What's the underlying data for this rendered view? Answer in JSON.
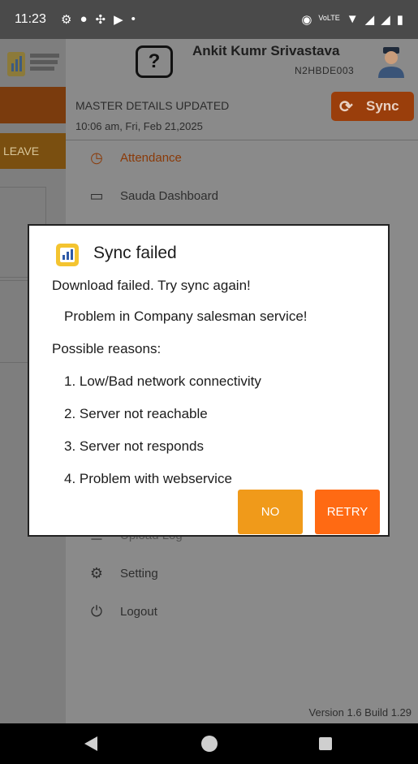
{
  "status_bar": {
    "time": "11:23",
    "left_icons": [
      "settings-icon",
      "chat-icon",
      "cast-icon",
      "youtube-icon",
      "dot-icon"
    ],
    "right_icons": [
      "location-icon",
      "volte-icon",
      "wifi-icon",
      "signal-icon",
      "signal-icon",
      "battery-icon"
    ]
  },
  "background": {
    "leave_label": "LEAVE"
  },
  "header": {
    "help_label": "?",
    "user_name": "Ankit Kumr Srivastava",
    "user_code": "N2HBDE003"
  },
  "sync_panel": {
    "status": "MASTER DETAILS UPDATED",
    "time": "10:06 am, Fri, Feb 21,2025",
    "sync_button": "Sync"
  },
  "menu": {
    "items": [
      {
        "label": "Attendance",
        "icon": "clock-icon"
      },
      {
        "label": "Sauda Dashboard",
        "icon": "monitor-icon"
      },
      {
        "label": "Upload Log",
        "icon": "upload-icon"
      },
      {
        "label": "Setting",
        "icon": "gear-icon"
      },
      {
        "label": "Logout",
        "icon": "power-icon"
      }
    ]
  },
  "version": "Version 1.6 Build 1.29",
  "dialog": {
    "title": "Sync failed",
    "message": "Download failed. Try sync again!",
    "detail": "Problem in Company salesman service!",
    "reasons_title": "Possible reasons:",
    "reasons": [
      "1. Low/Bad network connectivity",
      "2. Server not reachable",
      "3. Server not responds",
      "4. Problem with webservice"
    ],
    "no_button": "NO",
    "retry_button": "RETRY"
  },
  "colors": {
    "accent": "#ff6a13",
    "no_button": "#f09a1a",
    "scrim": "#7a7a7a"
  }
}
